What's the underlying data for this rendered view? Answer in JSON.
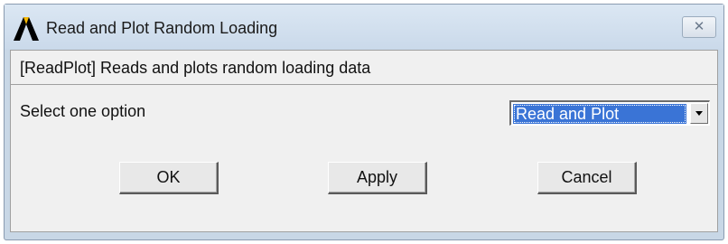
{
  "window": {
    "title": "Read and Plot Random Loading",
    "close_glyph": "✕"
  },
  "description": "[ReadPlot] Reads and plots random loading data",
  "option": {
    "label": "Select one option",
    "selected": "Read and Plot"
  },
  "buttons": {
    "ok": "OK",
    "apply": "Apply",
    "cancel": "Cancel"
  },
  "colors": {
    "titlebar": "#cad9ea",
    "client_bg": "#f0f0f0",
    "selection": "#3a74d6"
  },
  "icons": {
    "app_logo": "ansys-logo-icon",
    "close": "close-icon",
    "dropdown": "chevron-down-icon"
  }
}
